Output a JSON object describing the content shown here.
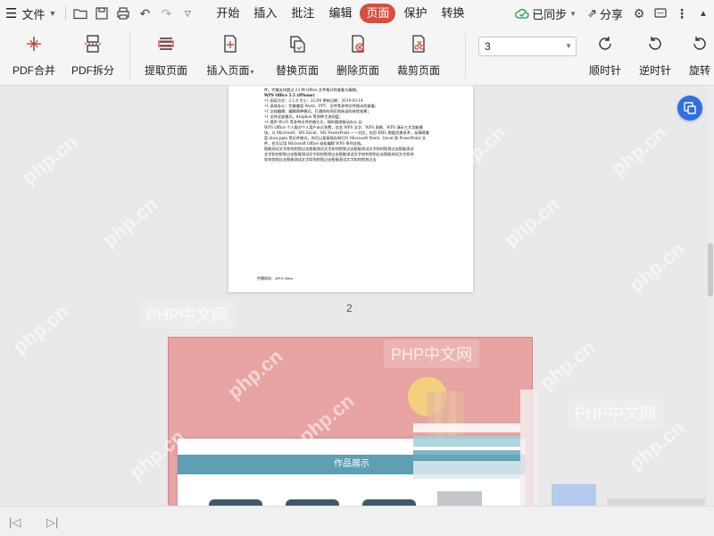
{
  "menubar": {
    "file_label": "文件",
    "tabs": [
      {
        "label": "开始",
        "active": false
      },
      {
        "label": "插入",
        "active": false
      },
      {
        "label": "批注",
        "active": false
      },
      {
        "label": "编辑",
        "active": false
      },
      {
        "label": "页面",
        "active": true
      },
      {
        "label": "保护",
        "active": false
      },
      {
        "label": "转换",
        "active": false
      }
    ],
    "sync_label": "已同步",
    "share_label": "分享"
  },
  "toolbar": {
    "tools": [
      {
        "label": "PDF合并",
        "icon": "merge-icon"
      },
      {
        "label": "PDF拆分",
        "icon": "split-icon"
      },
      {
        "label": "提取页面",
        "icon": "extract-icon"
      },
      {
        "label": "插入页面",
        "icon": "insert-page-icon",
        "dropdown": true
      },
      {
        "label": "替换页面",
        "icon": "replace-page-icon"
      },
      {
        "label": "删除页面",
        "icon": "delete-page-icon"
      },
      {
        "label": "裁剪页面",
        "icon": "crop-page-icon"
      },
      {
        "label": "顺时针",
        "icon": "rotate-cw-icon"
      },
      {
        "label": "逆时针",
        "icon": "rotate-ccw-icon"
      },
      {
        "label": "旋转",
        "icon": "rotate-icon"
      }
    ],
    "page_select_value": "3"
  },
  "document": {
    "page2_lines": [
      "件。完美支持超过 23 种 Office 文件格式的查看与编辑。",
      "WPS Office 5.5 (iPhone)",
      "•1 阅读方式：2.1.8 大小：212M 更新日期：2019-03-14",
      "•1 高效办公：完美兼容 Word、PPT、文件等多种文件格式的查看；",
      "•1 文档编辑：编辑两种模式，打通你的网页和阅读的体验效果；",
      "•1 支持全部格式，dropbox 等多种主流网盘；",
      "•1 提供 Wi-Fi 等多种文件传输方式，随时随地移动办公 @",
      "WPS Office 个人版对个人用户永久免费，包含 WPS 文字、WPS 表格、WPS 演示三大功能模",
      "块，与 Microsoft、MS Excel、MS PowerPoint 一一对应，应用 XML 数据交换技术，无障碍兼",
      "容 docx.pptx 等文件格式，你可以直接保存和打开 Microsoft Word、Excel 和 PowerPoint 文",
      "件，也可以用 Microsoft Office 轻松编辑 WPS 系列文档。",
      "智能测试文字如何划划过去智能测试文字如何划划过去智能测试文字如何划划过去智能测试",
      "文字如何划划过去智能测试文字如何划划过去智能测试文字如何划划过去智能测试文字如何",
      "如何划划过去智能测试文字如何划划过去智能测试文字如何划划过去"
    ],
    "page2_footer": "传播网站：WPS Office",
    "page_number": "2",
    "page3_banner": "作品展示"
  },
  "watermarks": {
    "boxed": "PHP中文网",
    "diagonal": "php.cn"
  }
}
